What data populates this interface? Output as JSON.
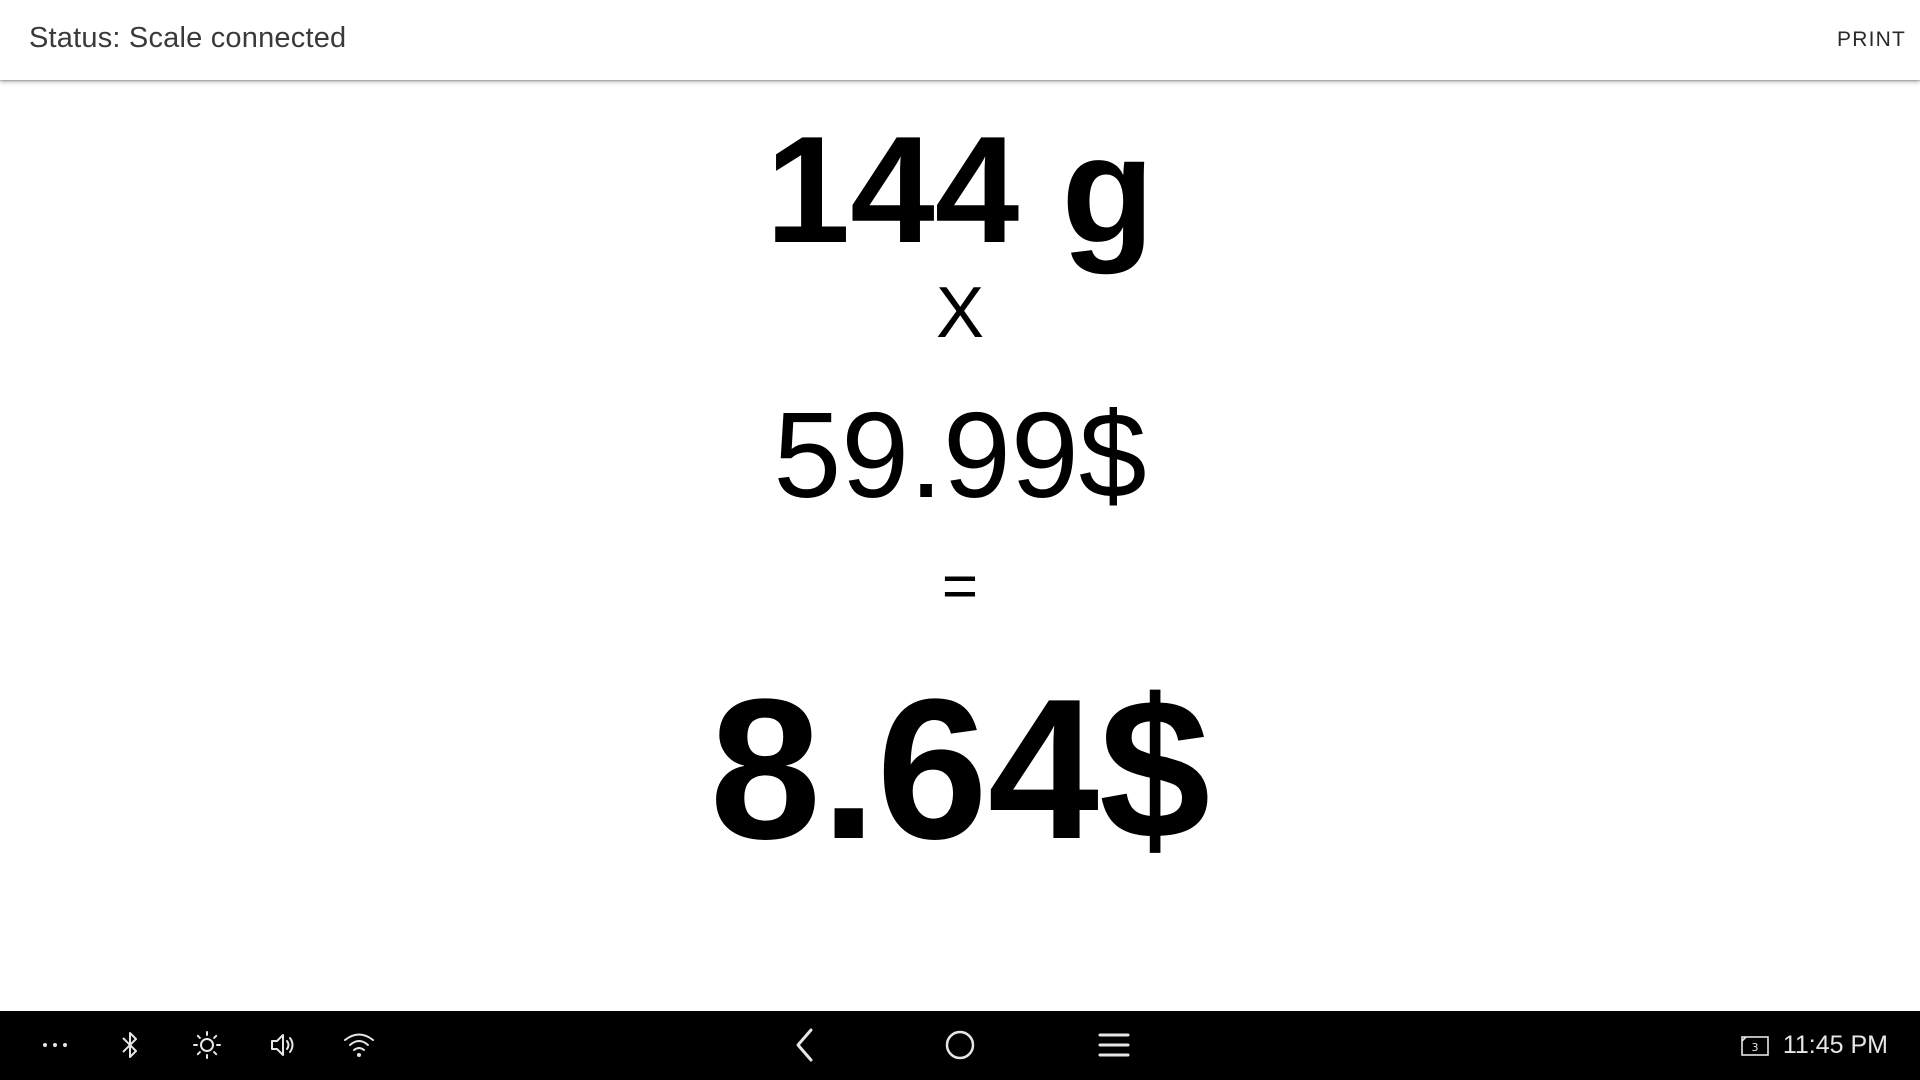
{
  "topbar": {
    "status_text": "Status: Scale connected",
    "print_label": "PRINT"
  },
  "calculation": {
    "weight": "144 g",
    "operator_multiply": "X",
    "unit_price": "59.99$",
    "operator_equals": "=",
    "total": "8.64$"
  },
  "system_bar": {
    "left_icons": [
      "more-horizontal-icon",
      "bluetooth-icon",
      "brightness-icon",
      "volume-icon",
      "wifi-icon"
    ],
    "nav_icons": [
      "back-icon",
      "home-icon",
      "menu-icon"
    ],
    "screen_badge_number": "3",
    "clock": "11:45 PM"
  },
  "colors": {
    "background": "#ffffff",
    "text": "#000000",
    "navbar": "#000000",
    "navbar_icons": "#e6e6e6"
  }
}
